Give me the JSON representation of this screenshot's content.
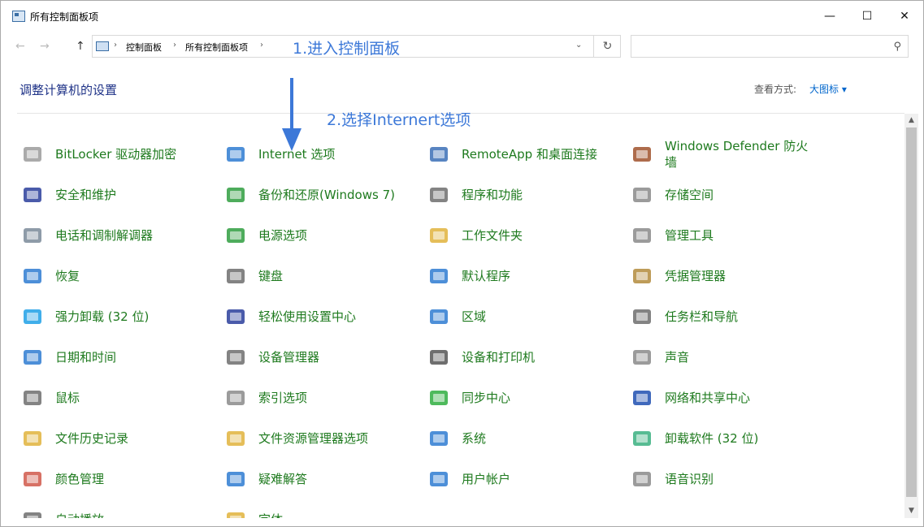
{
  "window": {
    "title": "所有控制面板项",
    "minimize": "—",
    "maximize": "☐",
    "close": "✕"
  },
  "nav": {
    "back": "←",
    "forward": "→",
    "up": "↑",
    "breadcrumb": [
      "控制面板",
      "所有控制面板项"
    ],
    "separator": "›",
    "dropdown": "⌄",
    "refresh": "↻",
    "search_placeholder": "",
    "search_icon": "⚲"
  },
  "annotations": {
    "step1": "1.进入控制面板",
    "step2": "2.选择Internert选项"
  },
  "header": {
    "title": "调整计算机的设置",
    "view_by_label": "查看方式:",
    "view_by_value": "大图标 ▾"
  },
  "items": [
    [
      "BitLocker 驱动器加密",
      "Internet 选项",
      "RemoteApp 和桌面连接",
      "Windows Defender 防火墙"
    ],
    [
      "安全和维护",
      "备份和还原(Windows 7)",
      "程序和功能",
      "存储空间"
    ],
    [
      "电话和调制解调器",
      "电源选项",
      "工作文件夹",
      "管理工具"
    ],
    [
      "恢复",
      "键盘",
      "默认程序",
      "凭据管理器"
    ],
    [
      "强力卸载 (32 位)",
      "轻松使用设置中心",
      "区域",
      "任务栏和导航"
    ],
    [
      "日期和时间",
      "设备管理器",
      "设备和打印机",
      "声音"
    ],
    [
      "鼠标",
      "索引选项",
      "同步中心",
      "网络和共享中心"
    ],
    [
      "文件历史记录",
      "文件资源管理器选项",
      "系统",
      "卸载软件 (32 位)"
    ],
    [
      "颜色管理",
      "疑难解答",
      "用户帐户",
      "语音识别"
    ],
    [
      "自动播放",
      "字体",
      "",
      ""
    ]
  ],
  "colors": {
    "link_green": "#1e7a1e",
    "heading_blue": "#1e3287",
    "annotation_blue": "#3c78d8"
  }
}
